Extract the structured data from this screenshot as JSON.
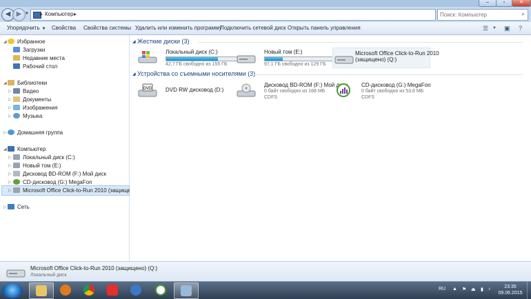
{
  "address": {
    "path": [
      "Компьютер"
    ],
    "search_placeholder": "Поиск: Компьютер"
  },
  "commands": [
    "Упорядочить",
    "Свойства",
    "Свойства системы",
    "Удалить или изменить программу",
    "Подключить сетевой диск",
    "Открыть панель управления"
  ],
  "nav": {
    "favorites": {
      "label": "Избранное",
      "items": [
        "Загрузки",
        "Недавние места",
        "Рабочий стол"
      ]
    },
    "libraries": {
      "label": "Библиотеки",
      "items": [
        "Видео",
        "Документы",
        "Изображения",
        "Музыка"
      ]
    },
    "homegroup": "Домашняя группа",
    "computer": {
      "label": "Компьютер",
      "items": [
        "Локальный диск (C:)",
        "Новый том (E:)",
        "Дисковод BD-ROM (F:) Мой диск",
        "CD-дисковод (G:) MegaFon",
        "Microsoft Office Click-to-Run 2010 (защищено) (Q:)"
      ]
    },
    "network": "Сеть"
  },
  "groups": {
    "hdd": {
      "title": "Жесткие диски (3)"
    },
    "removable": {
      "title": "Устройства со съемными носителями (3)"
    }
  },
  "drives": {
    "c": {
      "name": "Локальный диск (C:)",
      "free": "42,7 ГБ свободно из 155 ГБ",
      "used_fraction": 0.72
    },
    "e": {
      "name": "Новый том (E:)",
      "free": "97,1 ГБ свободно из 129 ГБ",
      "used_fraction": 0.25
    },
    "q": {
      "name1": "Microsoft Office Click-to-Run 2010",
      "name2": "(защищено) (Q:)"
    },
    "d": {
      "name": "DVD RW дисковод (D:)"
    },
    "f": {
      "name": "Дисковод BD-ROM (F:) Мой диск",
      "free": "0 байт свободно из 168 МБ",
      "fs": "CDFS"
    },
    "g": {
      "name": "CD-дисковод (G:) MegaFon",
      "free": "0 байт свободно из 53,6 МБ",
      "fs": "CDFS"
    }
  },
  "details": {
    "name": "Microsoft Office Click-to-Run 2010 (защищено) (Q:)",
    "type": "Локальный диск"
  },
  "taskbar": {
    "lang": "RU",
    "time": "23:35",
    "date": "09.06.2015"
  }
}
